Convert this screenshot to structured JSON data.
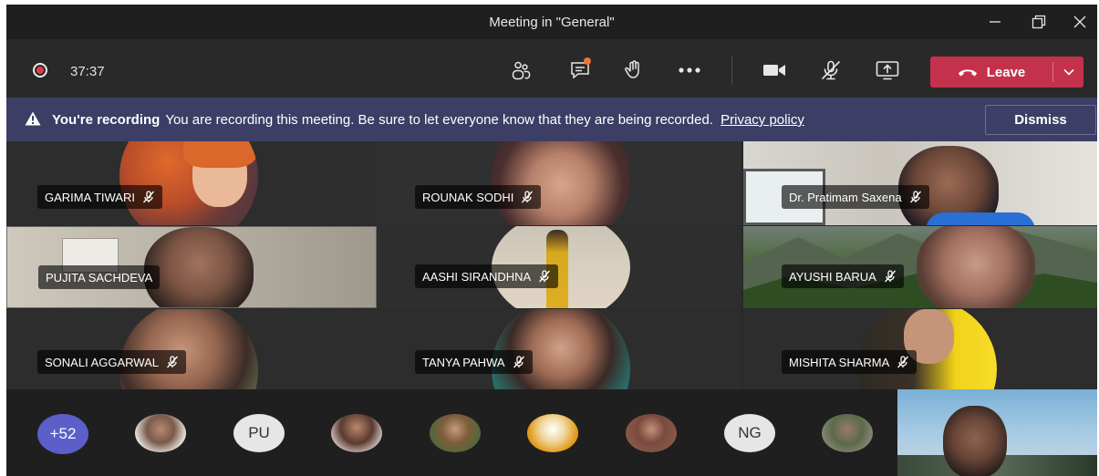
{
  "window": {
    "title": "Meeting in \"General\""
  },
  "toolbar": {
    "timer": "37:37",
    "leave_label": "Leave",
    "icons": [
      "participants-icon",
      "chat-icon",
      "raise-hand-icon",
      "more-options-icon",
      "camera-icon",
      "mic-muted-icon",
      "share-screen-icon"
    ]
  },
  "banner": {
    "heading": "You're recording",
    "message": "You are recording this meeting. Be sure to let everyone know that they are being recorded.",
    "link": "Privacy policy",
    "dismiss_label": "Dismiss"
  },
  "participants": [
    {
      "name": "GARIMA TIWARI",
      "muted": true
    },
    {
      "name": "ROUNAK SODHI",
      "muted": true
    },
    {
      "name": "Dr. Pratimam Saxena",
      "muted": true
    },
    {
      "name": "PUJITA SACHDEVA",
      "muted": false
    },
    {
      "name": "AASHI SIRANDHNA",
      "muted": true
    },
    {
      "name": "AYUSHI BARUA",
      "muted": true
    },
    {
      "name": "SONALI AGGARWAL",
      "muted": true
    },
    {
      "name": "TANYA PAHWA",
      "muted": true
    },
    {
      "name": "MISHITA SHARMA",
      "muted": true
    }
  ],
  "overflow": {
    "count_label": "+52",
    "initials": [
      "PU",
      "NG"
    ]
  },
  "colors": {
    "leave": "#c4314b",
    "banner": "#3d3e66",
    "overflow_badge": "#5b5fc7",
    "recording": "#e9384b"
  }
}
